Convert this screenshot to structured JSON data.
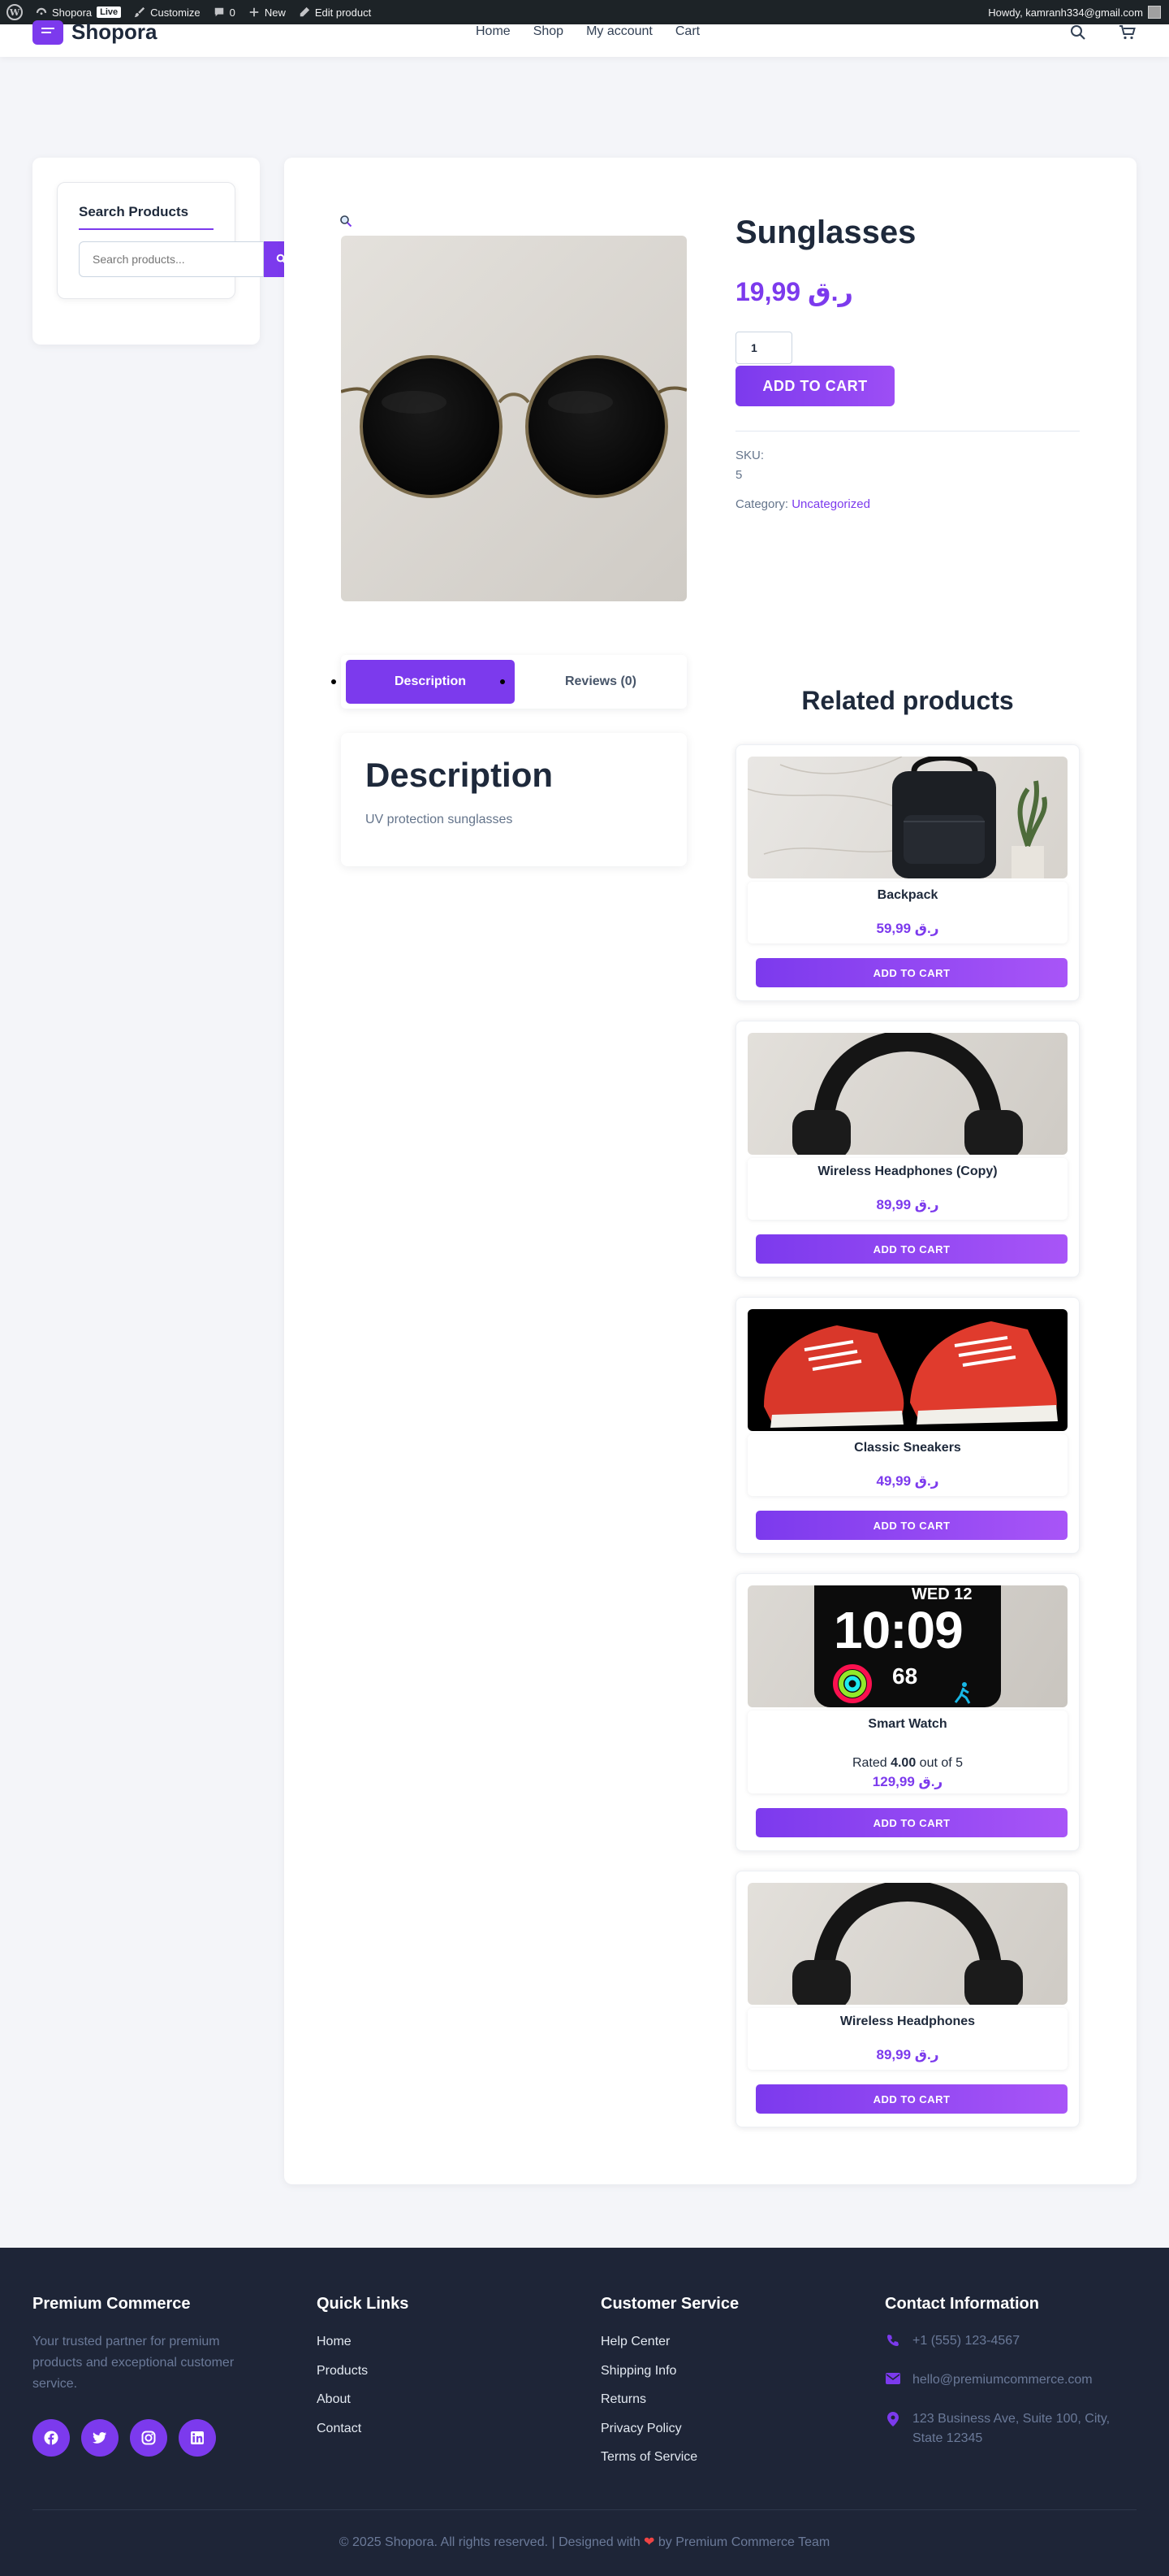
{
  "admin_bar": {
    "site_name": "Shopora",
    "live_badge": "Live",
    "customize": "Customize",
    "comments_count": "0",
    "new": "New",
    "edit_product": "Edit product",
    "howdy": "Howdy, kamranh334@gmail.com"
  },
  "header": {
    "logo_text": "Shopora",
    "nav": [
      "Home",
      "Shop",
      "My account",
      "Cart"
    ]
  },
  "sidebar": {
    "widget_title": "Search Products",
    "search_placeholder": "Search products..."
  },
  "product": {
    "title": "Sunglasses",
    "price": "ر.ق 19,99",
    "quantity": "1",
    "add_to_cart": "ADD TO CART",
    "sku_label": "SKU:",
    "sku_value": "5",
    "category_label": "Category:",
    "category_value": "Uncategorized"
  },
  "tabs": {
    "description_tab": "Description",
    "reviews_tab": "Reviews (0)",
    "description_heading": "Description",
    "description_text": "UV protection sunglasses"
  },
  "related": {
    "title": "Related products",
    "items": [
      {
        "name": "Backpack",
        "price": "ر.ق 59,99",
        "button": "ADD TO CART"
      },
      {
        "name": "Wireless Headphones (Copy)",
        "price": "ر.ق 89,99",
        "button": "ADD TO CART"
      },
      {
        "name": "Classic Sneakers",
        "price": "ر.ق 49,99",
        "button": "ADD TO CART"
      },
      {
        "name": "Smart Watch",
        "rating_prefix": "Rated ",
        "rating_value": "4.00",
        "rating_suffix": " out of 5",
        "price": "ر.ق 129,99",
        "button": "ADD TO CART",
        "watch_date": "WED 12",
        "watch_time": "10:09",
        "watch_num": "68"
      },
      {
        "name": "Wireless Headphones",
        "price": "ر.ق 89,99",
        "button": "ADD TO CART"
      }
    ]
  },
  "footer": {
    "brand_title": "Premium Commerce",
    "brand_text": "Your trusted partner for premium products and exceptional customer service.",
    "quick_links_title": "Quick Links",
    "quick_links": [
      "Home",
      "Products",
      "About",
      "Contact"
    ],
    "service_title": "Customer Service",
    "service_links": [
      "Help Center",
      "Shipping Info",
      "Returns",
      "Privacy Policy",
      "Terms of Service"
    ],
    "contact_title": "Contact Information",
    "phone": "+1 (555) 123-4567",
    "email": "hello@premiumcommerce.com",
    "address": "123 Business Ave, Suite 100, City, State 12345",
    "copyright_pre": "© 2025 Shopora. All rights reserved. | Designed with ",
    "copyright_post": " by Premium Commerce Team"
  },
  "colors": {
    "accent": "#7c3aed",
    "footer_bg": "#1e2537",
    "admin_bar_bg": "#1d2327"
  }
}
